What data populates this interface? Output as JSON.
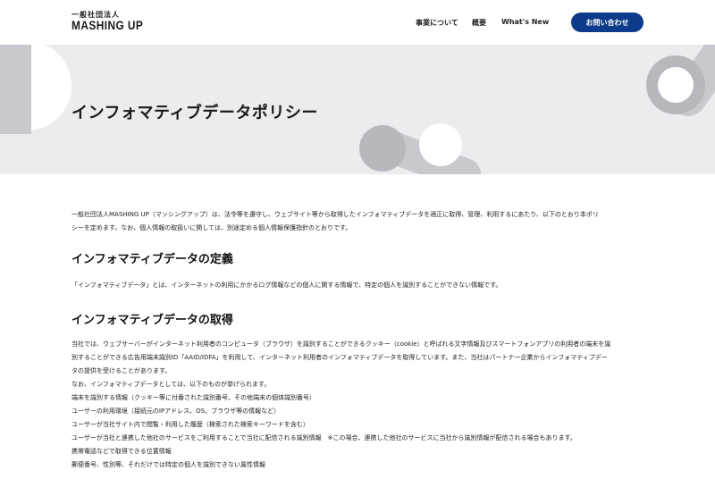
{
  "header": {
    "logo_small": "一般社団法人",
    "logo_big": "MASHING UP",
    "nav": [
      "事業について",
      "概要",
      "What's New"
    ],
    "contact_label": "お問い合わせ"
  },
  "hero": {
    "title": "インフォマティブデータポリシー"
  },
  "intro": [
    "一般社団法人MASHING UP（マッシングアップ）は、法令等を遵守し、ウェブサイト等から取得したインフォマティブデータを適正に取得、管理、利用するにあたり、以下のとおり本ポリ",
    "シーを定めます。なお、個人情報の取扱いに関しては、別途定める個人情報保護指針のとおりです。"
  ],
  "section1": {
    "heading": "インフォマティブデータの定義",
    "text": "「インフォマティブデータ」とは、インターネットの利用にかかるログ情報などの個人に関する情報で、特定の個人を識別することができない情報です。"
  },
  "section2": {
    "heading": "インフォマティブデータの取得",
    "lines": [
      "当社では、ウェブサーバーがインターネット利用者のコンピュータ（ブラウザ）を識別することができるクッキー（cookie）と呼ばれる文字情報及びスマートフォンアプリの利用者の端末を識",
      "別することができる広告用端末識別ID「AAID/IDFA」を利用して、インターネット利用者のインフォマティブデータを取得しています。また、当社はパートナー企業からインフォマティブデー",
      "タの提供を受けることがあります。",
      "なお、インフォマティブデータとしては、以下のものが挙げられます。",
      "端末を識別する情報（クッキー等に付番された識別番号、その他端末の個体識別番号）",
      "ユーザーの利用環境（接続元のIPアドレス、OS、ブラウザ等の情報など）",
      "ユーザーが当社サイト内で閲覧・利用した履歴（検索された検索キーワードを含む）",
      "ユーザーが当社と連携した他社のサービスをご利用することで当社に配信される識別情報　※この場合、連携した他社のサービスに当社から識別情報が配信される場合もあります。",
      "携帯電話などで取得できる位置情報",
      "郵便番号、性別等、それだけでは特定の個人を識別できない属性情報"
    ]
  }
}
